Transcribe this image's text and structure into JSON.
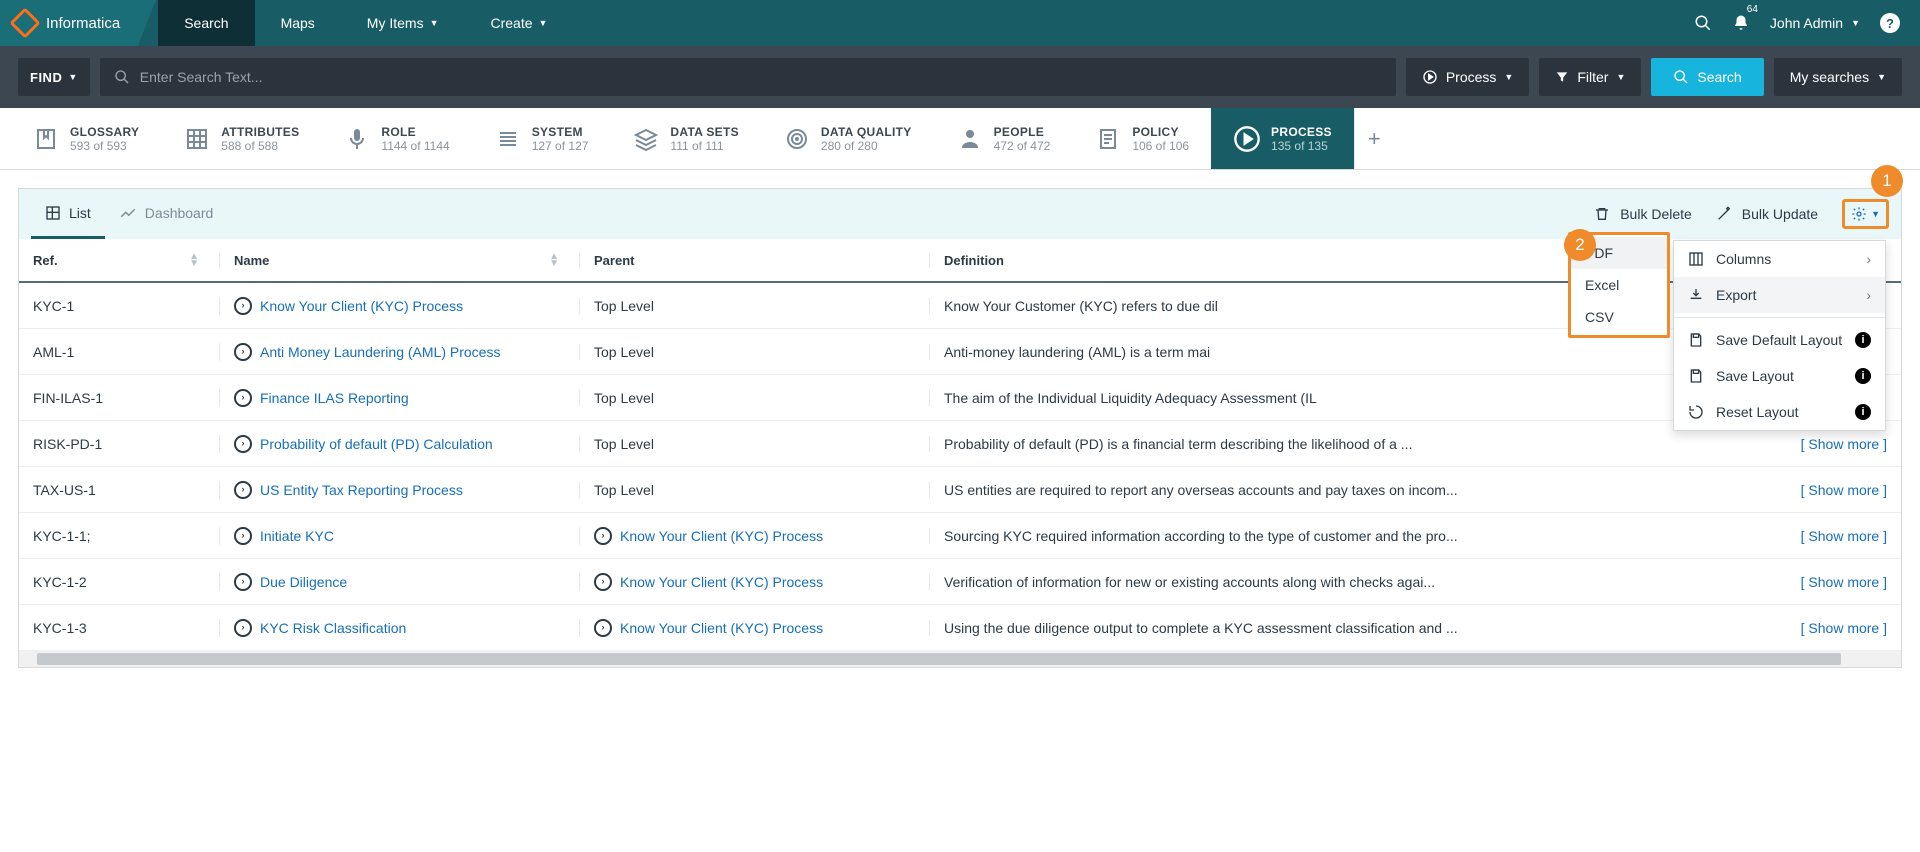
{
  "brand": "Informatica",
  "nav": {
    "tabs": [
      {
        "label": "Search",
        "active": true,
        "caret": false
      },
      {
        "label": "Maps",
        "active": false,
        "caret": false
      },
      {
        "label": "My Items",
        "active": false,
        "caret": true
      },
      {
        "label": "Create",
        "active": false,
        "caret": true
      }
    ],
    "notification_count": "64",
    "user": "John Admin"
  },
  "searchbar": {
    "find_label": "FIND",
    "placeholder": "Enter Search Text...",
    "process_label": "Process",
    "filter_label": "Filter",
    "search_label": "Search",
    "my_searches_label": "My searches"
  },
  "categories": [
    {
      "name": "GLOSSARY",
      "count": "593 of 593",
      "icon": "bookmark"
    },
    {
      "name": "ATTRIBUTES",
      "count": "588 of 588",
      "icon": "grid"
    },
    {
      "name": "ROLE",
      "count": "1144 of 1144",
      "icon": "mic"
    },
    {
      "name": "SYSTEM",
      "count": "127 of 127",
      "icon": "stack"
    },
    {
      "name": "DATA SETS",
      "count": "111 of 111",
      "icon": "layers"
    },
    {
      "name": "DATA QUALITY",
      "count": "280 of 280",
      "icon": "target"
    },
    {
      "name": "PEOPLE",
      "count": "472 of 472",
      "icon": "person"
    },
    {
      "name": "POLICY",
      "count": "106 of 106",
      "icon": "doc"
    },
    {
      "name": "PROCESS",
      "count": "135 of 135",
      "icon": "play-circle",
      "active": true
    }
  ],
  "panel": {
    "views": {
      "list": "List",
      "dashboard": "Dashboard"
    },
    "bulk_delete": "Bulk Delete",
    "bulk_update": "Bulk Update"
  },
  "columns": {
    "ref": "Ref.",
    "name": "Name",
    "parent": "Parent",
    "definition": "Definition"
  },
  "rows": [
    {
      "ref": "KYC-1",
      "name": "Know Your Client (KYC) Process",
      "parent": "Top Level",
      "parent_link": false,
      "def": "Know Your Customer (KYC) refers to due dil",
      "show_more": false
    },
    {
      "ref": "AML-1",
      "name": "Anti Money Laundering (AML) Process",
      "parent": "Top Level",
      "parent_link": false,
      "def": "Anti-money laundering (AML) is a term mai",
      "show_more": false
    },
    {
      "ref": "FIN-ILAS-1",
      "name": "Finance ILAS Reporting",
      "parent": "Top Level",
      "parent_link": false,
      "def": "The aim of the Individual Liquidity Adequacy Assessment (IL",
      "show_more": false
    },
    {
      "ref": "RISK-PD-1",
      "name": "Probability of default (PD) Calculation",
      "parent": "Top Level",
      "parent_link": false,
      "def": "Probability of default (PD) is a financial term describing the likelihood of a ...",
      "show_more": true
    },
    {
      "ref": "TAX-US-1",
      "name": "US Entity Tax Reporting Process",
      "parent": "Top Level",
      "parent_link": false,
      "def": "US entities are required to report any overseas accounts and pay taxes on incom...",
      "show_more": true
    },
    {
      "ref": "KYC-1-1;",
      "name": "Initiate KYC",
      "parent": "Know Your Client (KYC) Process",
      "parent_link": true,
      "def": "Sourcing KYC required information according to the type of customer and the pro...",
      "show_more": true
    },
    {
      "ref": "KYC-1-2",
      "name": "Due Diligence",
      "parent": "Know Your Client (KYC) Process",
      "parent_link": true,
      "def": "Verification of information for new or existing accounts along with checks agai...",
      "show_more": true
    },
    {
      "ref": "KYC-1-3",
      "name": "KYC Risk Classification",
      "parent": "Know Your Client (KYC) Process",
      "parent_link": true,
      "def": "Using the due diligence output to complete a KYC assessment classification and ...",
      "show_more": true
    }
  ],
  "show_more_label": "[ Show more ]",
  "settings_menu": {
    "columns": "Columns",
    "export": "Export",
    "save_default": "Save Default Layout",
    "save_layout": "Save Layout",
    "reset_layout": "Reset Layout"
  },
  "export_options": [
    "PDF",
    "Excel",
    "CSV"
  ],
  "tutorial": {
    "marker1": "1",
    "marker2": "2"
  }
}
